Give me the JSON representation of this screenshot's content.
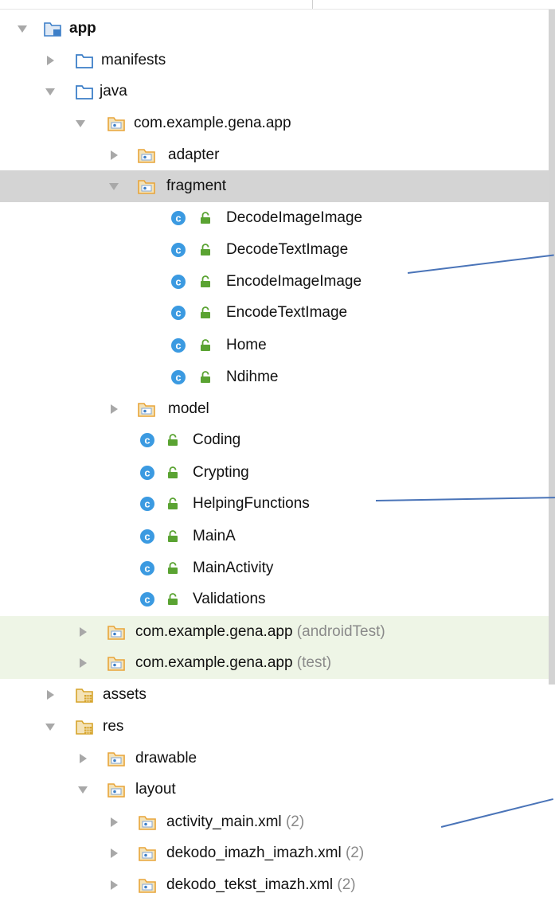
{
  "tree": {
    "app": {
      "label": "app"
    },
    "manifests": {
      "label": "manifests"
    },
    "java": {
      "label": "java"
    },
    "pkg_main": {
      "label": "com.example.gena.app"
    },
    "adapter": {
      "label": "adapter"
    },
    "fragment": {
      "label": "fragment"
    },
    "fragment_classes": [
      "DecodeImageImage",
      "DecodeTextImage",
      "EncodeImageImage",
      "EncodeTextImage",
      "Home",
      "Ndihme"
    ],
    "model": {
      "label": "model"
    },
    "pkg_classes": [
      "Coding",
      "Crypting",
      "HelpingFunctions",
      "MainA",
      "MainActivity",
      "Validations"
    ],
    "pkg_android_test": {
      "label": "com.example.gena.app",
      "suffix": "(androidTest)"
    },
    "pkg_test": {
      "label": "com.example.gena.app",
      "suffix": "(test)"
    },
    "assets": {
      "label": "assets"
    },
    "res": {
      "label": "res"
    },
    "drawable": {
      "label": "drawable"
    },
    "layout": {
      "label": "layout"
    },
    "layout_files": [
      {
        "label": "activity_main.xml",
        "count": "(2)"
      },
      {
        "label": "dekodo_imazh_imazh.xml",
        "count": "(2)"
      },
      {
        "label": "dekodo_tekst_imazh.xml",
        "count": "(2)"
      }
    ]
  },
  "icons": {
    "folder_color": "#3d7fc8",
    "package_color": "#e8a53a",
    "class_color": "#3b9ae1",
    "lock_color": "#5aa332",
    "resource_color": "#d6a42b",
    "annotation_line_color": "#4a74b8"
  }
}
